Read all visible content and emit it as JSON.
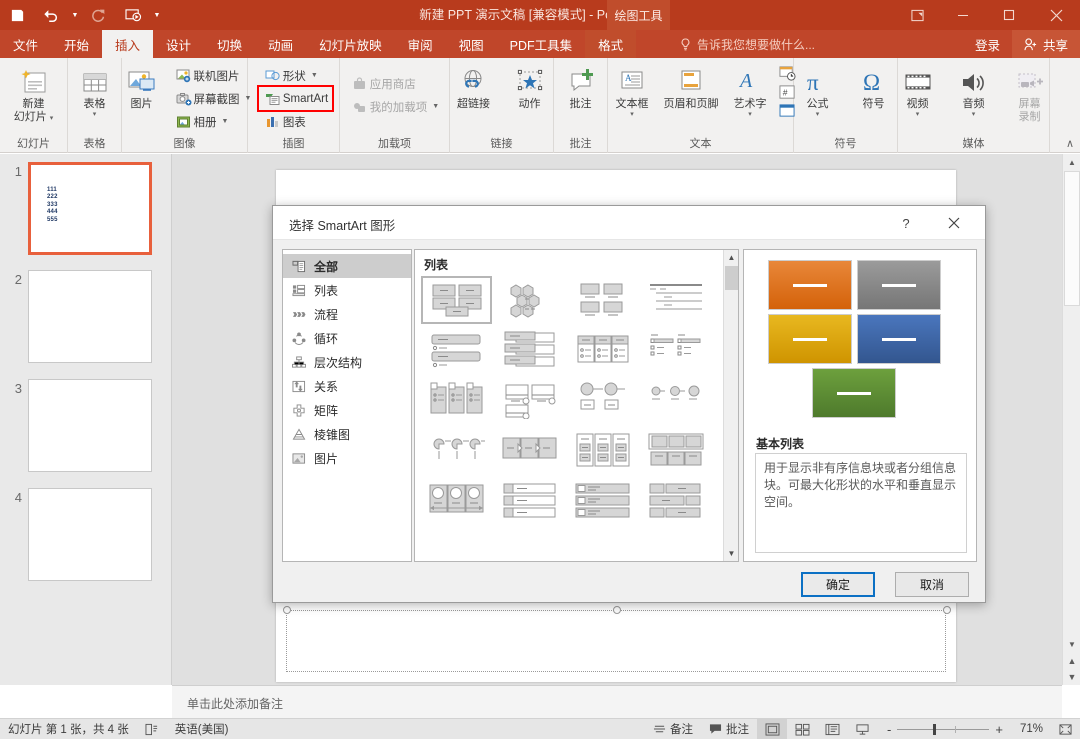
{
  "titlebar": {
    "document_title": "新建 PPT 演示文稿 [兼容模式] - PowerPoint",
    "context_tab_group": "绘图工具",
    "qat": [
      {
        "name": "save",
        "glyph": "💾"
      },
      {
        "name": "undo",
        "glyph": "↶"
      },
      {
        "name": "redo",
        "glyph": "↷"
      },
      {
        "name": "start-slideshow",
        "glyph": "▷"
      },
      {
        "name": "customize-qat",
        "glyph": "▾"
      }
    ],
    "window_controls": [
      {
        "name": "ribbon-display-options",
        "glyph": "⬚"
      },
      {
        "name": "minimize",
        "glyph": "—"
      },
      {
        "name": "maximize",
        "glyph": "☐"
      },
      {
        "name": "close",
        "glyph": "✕"
      }
    ]
  },
  "tabs": [
    {
      "label": "文件",
      "active": false
    },
    {
      "label": "开始",
      "active": false
    },
    {
      "label": "插入",
      "active": true
    },
    {
      "label": "设计",
      "active": false
    },
    {
      "label": "切换",
      "active": false
    },
    {
      "label": "动画",
      "active": false
    },
    {
      "label": "幻灯片放映",
      "active": false
    },
    {
      "label": "审阅",
      "active": false
    },
    {
      "label": "视图",
      "active": false
    },
    {
      "label": "PDF工具集",
      "active": false
    },
    {
      "label": "格式",
      "active": false,
      "contextual": true
    }
  ],
  "tellme": {
    "placeholder": "告诉我您想要做什么..."
  },
  "account": {
    "signin": "登录",
    "share": "共享"
  },
  "ribbon": {
    "collapse_glyph": "∧",
    "groups": [
      {
        "label": "幻灯片",
        "big": [
          {
            "name": "new-slide",
            "label": "新建\n幻灯片",
            "caret": true
          }
        ]
      },
      {
        "label": "表格",
        "big": [
          {
            "name": "table",
            "label": "表格",
            "caret": true
          }
        ]
      },
      {
        "label": "图像",
        "big": [
          {
            "name": "pictures",
            "label": "图片",
            "caret": false
          }
        ],
        "small": [
          {
            "name": "online-pictures",
            "label": "联机图片",
            "caret": false,
            "disabled": false
          },
          {
            "name": "screenshot",
            "label": "屏幕截图",
            "caret": true,
            "disabled": false
          },
          {
            "name": "photo-album",
            "label": "相册",
            "caret": true,
            "disabled": false
          }
        ]
      },
      {
        "label": "插图",
        "small": [
          {
            "name": "shapes",
            "label": "形状",
            "caret": true,
            "disabled": false
          },
          {
            "name": "smartart",
            "label": "SmartArt",
            "caret": false,
            "disabled": false,
            "highlighted": true
          },
          {
            "name": "chart",
            "label": "图表",
            "caret": false,
            "disabled": false
          }
        ]
      },
      {
        "label": "加载项",
        "small": [
          {
            "name": "app-store",
            "label": "应用商店",
            "caret": false,
            "disabled": true
          },
          {
            "name": "my-addins",
            "label": "我的加载项",
            "caret": true,
            "disabled": true
          }
        ]
      },
      {
        "label": "链接",
        "big": [
          {
            "name": "hyperlink",
            "label": "超链接",
            "caret": false
          },
          {
            "name": "action",
            "label": "动作",
            "caret": false
          }
        ]
      },
      {
        "label": "批注",
        "big": [
          {
            "name": "comment",
            "label": "批注",
            "caret": false
          }
        ]
      },
      {
        "label": "文本",
        "big": [
          {
            "name": "text-box",
            "label": "文本框",
            "caret": true
          },
          {
            "name": "header-footer",
            "label": "页眉和页脚",
            "caret": false
          },
          {
            "name": "word-art",
            "label": "艺术字",
            "caret": true
          }
        ],
        "stack": [
          {
            "name": "date-time",
            "label": ""
          },
          {
            "name": "slide-number",
            "label": ""
          },
          {
            "name": "object",
            "label": ""
          }
        ]
      },
      {
        "label": "符号",
        "big": [
          {
            "name": "equation",
            "label": "公式",
            "caret": true
          },
          {
            "name": "symbol",
            "label": "符号",
            "caret": false
          }
        ]
      },
      {
        "label": "媒体",
        "big": [
          {
            "name": "video",
            "label": "视频",
            "caret": true
          },
          {
            "name": "audio",
            "label": "音频",
            "caret": true
          },
          {
            "name": "screen-recording",
            "label": "屏幕\n录制",
            "caret": false,
            "disabled": true
          }
        ]
      }
    ]
  },
  "thumbnails": [
    {
      "number": "1",
      "selected": true,
      "lines": [
        "111",
        "222",
        "333",
        "444",
        "555"
      ]
    },
    {
      "number": "2",
      "selected": false,
      "lines": []
    },
    {
      "number": "3",
      "selected": false,
      "lines": []
    },
    {
      "number": "4",
      "selected": false,
      "lines": []
    }
  ],
  "notes": {
    "placeholder": "单击此处添加备注"
  },
  "statusbar": {
    "slide_count": "幻灯片 第 1 张，共 4 张",
    "language": "英语(美国)",
    "notes_btn": "备注",
    "comments_btn": "批注",
    "views": [
      {
        "name": "normal-view",
        "active": true
      },
      {
        "name": "slide-sorter-view",
        "active": false
      },
      {
        "name": "reading-view",
        "active": false
      },
      {
        "name": "slideshow-view",
        "active": false
      }
    ],
    "zoom_out": "-",
    "zoom_in": "+",
    "zoom_value": "71%",
    "fit_to_window": "fit-slide-icon"
  },
  "dialog": {
    "title": "选择 SmartArt 图形",
    "help_glyph": "?",
    "close_glyph": "✕",
    "categories": [
      {
        "label": "全部",
        "icon": "all-icon",
        "selected": true
      },
      {
        "label": "列表",
        "icon": "list-icon",
        "selected": false
      },
      {
        "label": "流程",
        "icon": "process-icon",
        "selected": false
      },
      {
        "label": "循环",
        "icon": "cycle-icon",
        "selected": false
      },
      {
        "label": "层次结构",
        "icon": "hierarchy-icon",
        "selected": false
      },
      {
        "label": "关系",
        "icon": "relationship-icon",
        "selected": false
      },
      {
        "label": "矩阵",
        "icon": "matrix-icon",
        "selected": false
      },
      {
        "label": "棱锥图",
        "icon": "pyramid-icon",
        "selected": false
      },
      {
        "label": "图片",
        "icon": "picture-icon",
        "selected": false
      }
    ],
    "gallery_heading": "列表",
    "gallery_items": [
      {
        "name": "basic-block-list",
        "selected": true
      },
      {
        "name": "alternating-hexagons",
        "selected": false
      },
      {
        "name": "picture-caption-list",
        "selected": false
      },
      {
        "name": "lined-list",
        "selected": false
      },
      {
        "name": "vertical-bullet-list",
        "selected": false
      },
      {
        "name": "vertical-box-list",
        "selected": false
      },
      {
        "name": "horizontal-bullet-list",
        "selected": false
      },
      {
        "name": "square-accent-list",
        "selected": false
      },
      {
        "name": "picture-accent-list",
        "selected": false
      },
      {
        "name": "bending-picture-blocks",
        "selected": false
      },
      {
        "name": "stacked-list",
        "selected": false
      },
      {
        "name": "increasing-circle-process",
        "selected": false
      },
      {
        "name": "pie-process",
        "selected": false
      },
      {
        "name": "detailed-process",
        "selected": false
      },
      {
        "name": "grouped-list",
        "selected": false
      },
      {
        "name": "horizontal-picture-list",
        "selected": false
      },
      {
        "name": "continuous-picture-list",
        "selected": false
      },
      {
        "name": "tab-list",
        "selected": false
      },
      {
        "name": "vertical-picture-accent-list",
        "selected": false
      },
      {
        "name": "alternating-picture-blocks",
        "selected": false
      }
    ],
    "preview": {
      "name": "基本列表",
      "description": "用于显示非有序信息块或者分组信息块。可最大化形状的水平和垂直显示空间。",
      "shape_colors": [
        "#E36C0A",
        "#808080",
        "#E0A800",
        "#3D64A8",
        "#5F8F34"
      ]
    },
    "buttons": {
      "ok": "确定",
      "cancel": "取消"
    }
  }
}
